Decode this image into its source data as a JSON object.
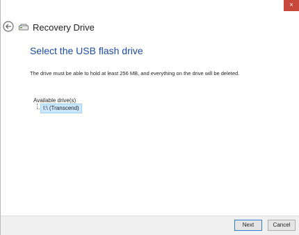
{
  "window": {
    "close_glyph": "×",
    "app_title": "Recovery Drive"
  },
  "icons": {
    "back": "back-arrow-icon",
    "drive": "drive-icon",
    "close": "close-icon"
  },
  "main": {
    "heading": "Select the USB flash drive",
    "description": "The drive must be able to hold at least 256 MB, and everything on the drive will be deleted.",
    "drives_label": "Available drive(s)",
    "drives": [
      {
        "label": "I:\\ (Transcend)",
        "selected": true
      }
    ]
  },
  "footer": {
    "next_label": "Next",
    "cancel_label": "Cancel"
  },
  "colors": {
    "heading": "#1c4ca3",
    "close_button": "#c8473b",
    "selection": "#cce8ff"
  }
}
